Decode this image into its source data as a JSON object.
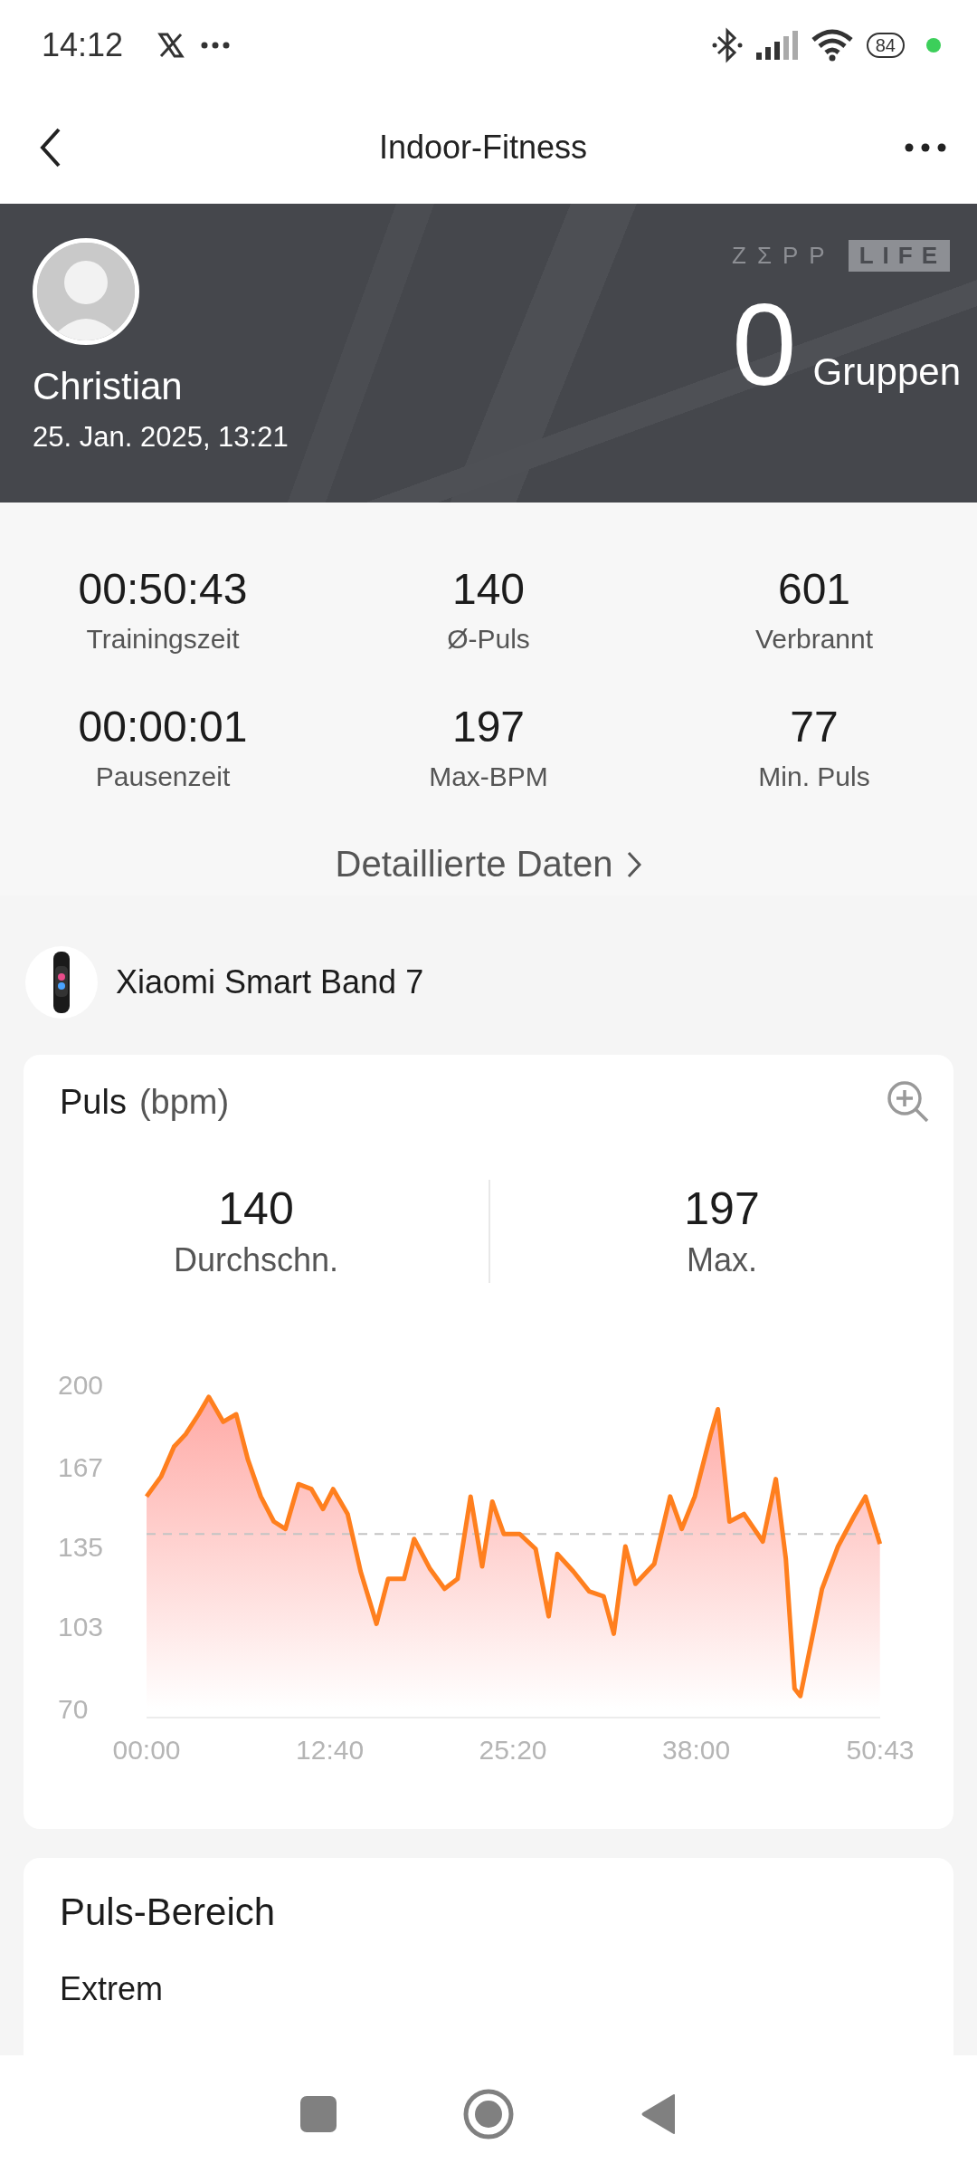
{
  "status_bar": {
    "time": "14:12",
    "battery": "84"
  },
  "header": {
    "title": "Indoor-Fitness"
  },
  "banner": {
    "logo_left": "ZΣPP",
    "logo_right": "LIFE",
    "name": "Christian",
    "date": "25. Jan. 2025, 13:21",
    "count": "0",
    "count_label": "Gruppen"
  },
  "stats": [
    {
      "value": "00:50:43",
      "label": "Trainingszeit"
    },
    {
      "value": "140",
      "label": "Ø-Puls"
    },
    {
      "value": "601",
      "label": "Verbrannt"
    },
    {
      "value": "00:00:01",
      "label": "Pausenzeit"
    },
    {
      "value": "197",
      "label": "Max-BPM"
    },
    {
      "value": "77",
      "label": "Min. Puls"
    }
  ],
  "details_link": "Detaillierte Daten",
  "device": {
    "name": "Xiaomi Smart Band 7"
  },
  "heart_card": {
    "title": "Puls",
    "unit": "(bpm)",
    "summary": [
      {
        "value": "140",
        "label": "Durchschn."
      },
      {
        "value": "197",
        "label": "Max."
      }
    ],
    "chart_data": {
      "type": "area",
      "x": [
        0,
        1,
        1.9,
        2.7,
        3.6,
        4.3,
        5.3,
        6.2,
        7,
        7.9,
        8.8,
        9.6,
        10.5,
        11.4,
        12.2,
        12.9,
        13.9,
        14.8,
        15.9,
        16.7,
        17.8,
        18.5,
        19.6,
        20.6,
        21.5,
        22.4,
        23.2,
        23.9,
        24.7,
        25.8,
        26.9,
        27.8,
        28.4,
        29.5,
        30.6,
        31.6,
        32.3,
        33.1,
        33.8,
        35.1,
        36.2,
        37,
        37.9,
        39,
        39.5,
        40.3,
        41.3,
        42.6,
        43.5,
        44.2,
        44.8,
        45.2,
        45.9,
        46.7,
        47.8,
        48.9,
        49.7,
        50.7
      ],
      "series": [
        {
          "color": "#ff7f1e",
          "values": [
            155,
            163,
            175,
            180,
            188,
            195,
            185,
            188,
            170,
            155,
            145,
            142,
            160,
            158,
            150,
            158,
            148,
            125,
            104,
            122,
            122,
            138,
            126,
            118,
            122,
            155,
            127,
            153,
            140,
            140,
            134,
            107,
            132,
            125,
            117,
            115,
            100,
            135,
            120,
            128,
            155,
            142,
            155,
            180,
            190,
            145,
            148,
            137,
            162,
            130,
            78,
            75,
            95,
            118,
            135,
            147,
            155,
            136
          ]
        }
      ],
      "xlim": [
        0,
        50.72
      ],
      "ylim": [
        70,
        200
      ],
      "yticks": [
        70,
        103,
        135,
        167,
        200
      ],
      "xticks": [
        {
          "value": 0,
          "label": "00:00"
        },
        {
          "value": 12.67,
          "label": "12:40"
        },
        {
          "value": 25.33,
          "label": "25:20"
        },
        {
          "value": 38,
          "label": "38:00"
        },
        {
          "value": 50.72,
          "label": "50:43"
        }
      ],
      "ref_lines": [
        {
          "axis": "y",
          "value": 140
        }
      ]
    }
  },
  "zone_card": {
    "title": "Puls-Bereich",
    "zone": "Extrem"
  }
}
